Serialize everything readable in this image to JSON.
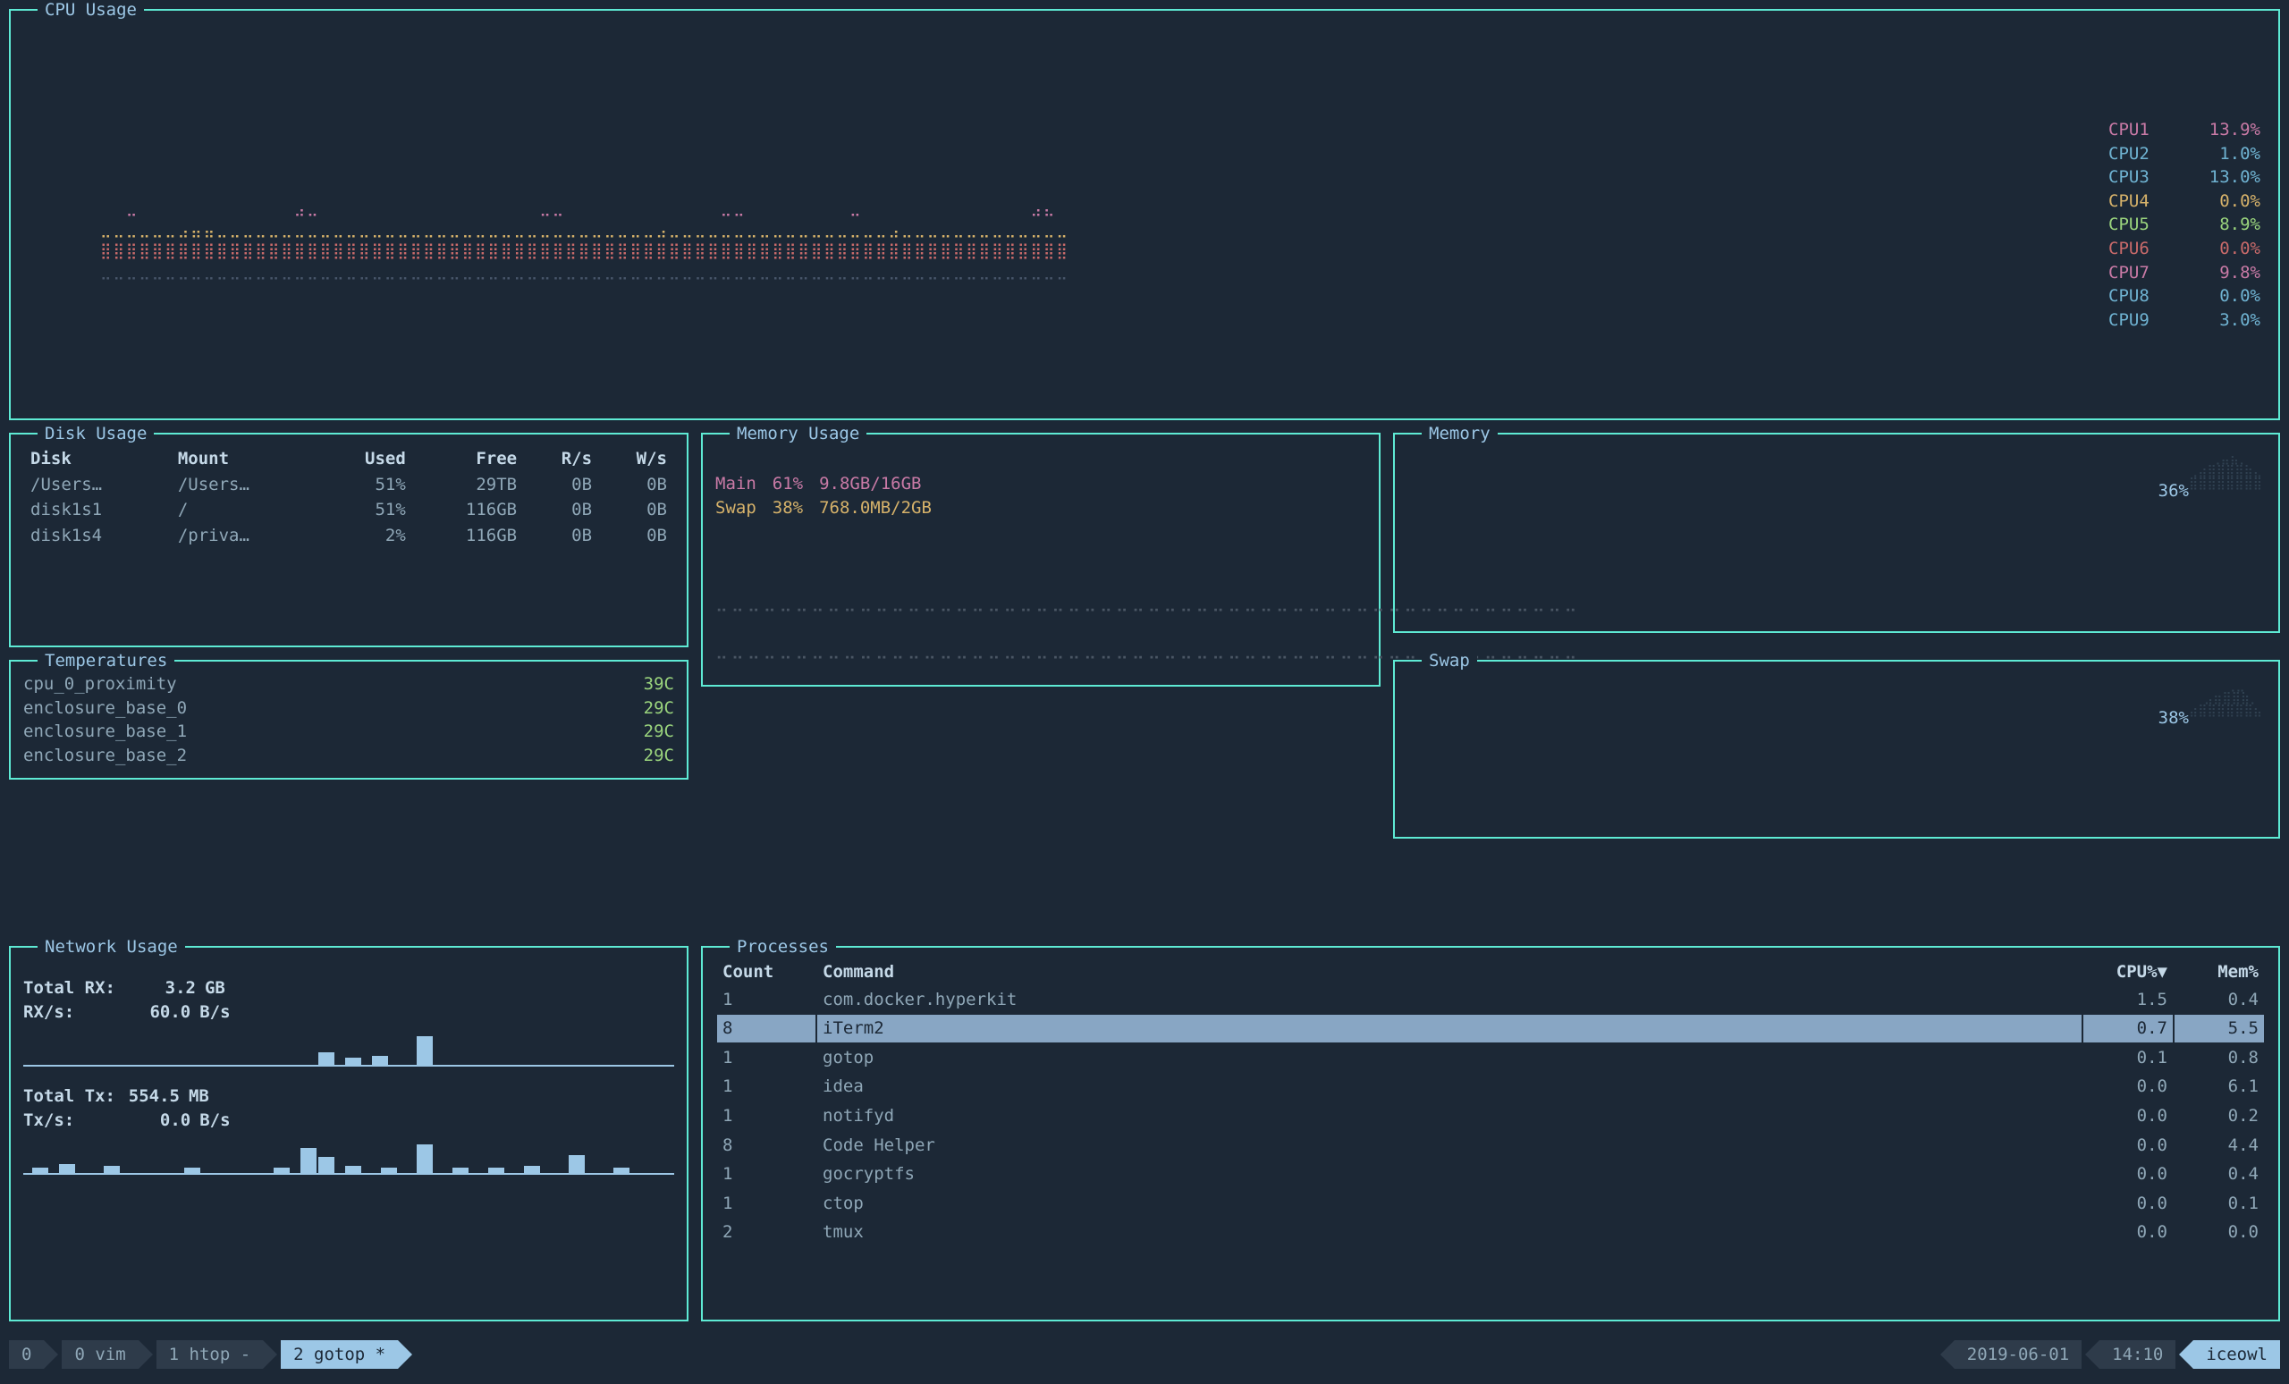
{
  "cpu": {
    "title": "CPU Usage",
    "cores": [
      {
        "name": "CPU1",
        "value": "13.9%",
        "color": "#c97aa6"
      },
      {
        "name": "CPU2",
        "value": "1.0%",
        "color": "#6fb3d2"
      },
      {
        "name": "CPU3",
        "value": "13.0%",
        "color": "#6fb3d2"
      },
      {
        "name": "CPU4",
        "value": "0.0%",
        "color": "#d6b26a"
      },
      {
        "name": "CPU5",
        "value": "8.9%",
        "color": "#9ad47d"
      },
      {
        "name": "CPU6",
        "value": "0.0%",
        "color": "#c96a6a"
      },
      {
        "name": "CPU7",
        "value": "9.8%",
        "color": "#c97aa6"
      },
      {
        "name": "CPU8",
        "value": "0.0%",
        "color": "#6fb3d2"
      },
      {
        "name": "CPU9",
        "value": "3.0%",
        "color": "#6fb3d2"
      }
    ]
  },
  "disk": {
    "title": "Disk Usage",
    "headers": {
      "disk": "Disk",
      "mount": "Mount",
      "used": "Used",
      "free": "Free",
      "rs": "R/s",
      "ws": "W/s"
    },
    "rows": [
      {
        "disk": "/Users…",
        "mount": "/Users…",
        "used": "51%",
        "free": "29TB",
        "rs": "0B",
        "ws": "0B"
      },
      {
        "disk": "disk1s1",
        "mount": "/",
        "used": "51%",
        "free": "116GB",
        "rs": "0B",
        "ws": "0B"
      },
      {
        "disk": "disk1s4",
        "mount": "/priva…",
        "used": "2%",
        "free": "116GB",
        "rs": "0B",
        "ws": "0B"
      }
    ]
  },
  "temps": {
    "title": "Temperatures",
    "rows": [
      {
        "name": "cpu_0_proximity",
        "value": "39C"
      },
      {
        "name": "enclosure_base_0",
        "value": "29C"
      },
      {
        "name": "enclosure_base_1",
        "value": "29C"
      },
      {
        "name": "enclosure_base_2",
        "value": "29C"
      }
    ]
  },
  "mem": {
    "title": "Memory Usage",
    "main": {
      "label": "Main",
      "pct": "61%",
      "detail": "9.8GB/16GB"
    },
    "swap": {
      "label": "Swap",
      "pct": "38%",
      "detail": "768.0MB/2GB"
    }
  },
  "mem_spark": {
    "title": "Memory",
    "value": "36%"
  },
  "swap_spark": {
    "title": "Swap",
    "value": "38%"
  },
  "net": {
    "title": "Network Usage",
    "rx_total_label": "Total RX:",
    "rx_total": "3.2",
    "rx_total_unit": "GB",
    "rx_rate_label": "RX/s:",
    "rx_rate": "60.0",
    "rx_rate_unit": "B/s",
    "tx_total_label": "Total Tx:",
    "tx_total": "554.5",
    "tx_total_unit": "MB",
    "tx_rate_label": "Tx/s:",
    "tx_rate": "0.0",
    "tx_rate_unit": "B/s"
  },
  "proc": {
    "title": "Processes",
    "headers": {
      "count": "Count",
      "command": "Command",
      "cpu": "CPU%▼",
      "mem": "Mem%"
    },
    "rows": [
      {
        "count": "1",
        "command": "com.docker.hyperkit",
        "cpu": "1.5",
        "mem": "0.4",
        "sel": false
      },
      {
        "count": "8",
        "command": "iTerm2",
        "cpu": "0.7",
        "mem": "5.5",
        "sel": true
      },
      {
        "count": "1",
        "command": "gotop",
        "cpu": "0.1",
        "mem": "0.8",
        "sel": false
      },
      {
        "count": "1",
        "command": "idea",
        "cpu": "0.0",
        "mem": "6.1",
        "sel": false
      },
      {
        "count": "1",
        "command": "notifyd",
        "cpu": "0.0",
        "mem": "0.2",
        "sel": false
      },
      {
        "count": "8",
        "command": "Code Helper",
        "cpu": "0.0",
        "mem": "4.4",
        "sel": false
      },
      {
        "count": "1",
        "command": "gocryptfs",
        "cpu": "0.0",
        "mem": "0.4",
        "sel": false
      },
      {
        "count": "1",
        "command": "ctop",
        "cpu": "0.0",
        "mem": "0.1",
        "sel": false
      },
      {
        "count": "2",
        "command": "tmux",
        "cpu": "0.0",
        "mem": "0.0",
        "sel": false
      }
    ]
  },
  "status": {
    "session": "0",
    "tabs": [
      {
        "idx": "0",
        "name": "vim",
        "suffix": ""
      },
      {
        "idx": "1",
        "name": "htop",
        "suffix": "-"
      },
      {
        "idx": "2",
        "name": "gotop",
        "suffix": "*"
      }
    ],
    "date": "2019-06-01",
    "time": "14:10",
    "host": "iceowl"
  },
  "chart_data": {
    "type": "line",
    "title": "CPU Usage",
    "series": [
      {
        "name": "CPU1",
        "latest": 13.9
      },
      {
        "name": "CPU2",
        "latest": 1.0
      },
      {
        "name": "CPU3",
        "latest": 13.0
      },
      {
        "name": "CPU4",
        "latest": 0.0
      },
      {
        "name": "CPU5",
        "latest": 8.9
      },
      {
        "name": "CPU6",
        "latest": 0.0
      },
      {
        "name": "CPU7",
        "latest": 9.8
      },
      {
        "name": "CPU8",
        "latest": 0.0
      },
      {
        "name": "CPU9",
        "latest": 3.0
      }
    ],
    "ylim": [
      0,
      100
    ],
    "ylabel": "%"
  }
}
